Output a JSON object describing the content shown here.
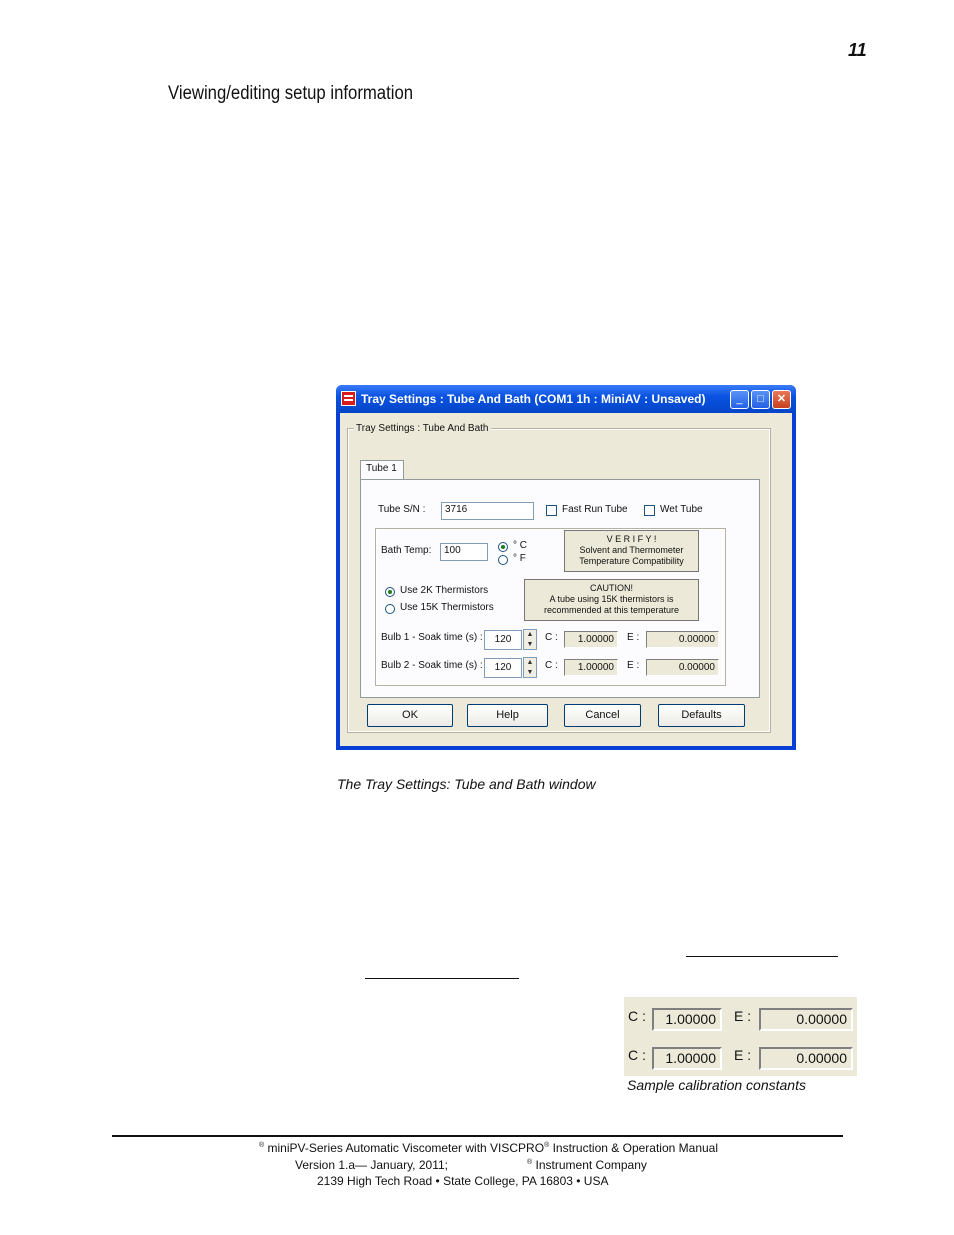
{
  "page": {
    "page_number": "11",
    "section_title": "Viewing/editing setup information"
  },
  "dialog": {
    "title": "Tray Settings : Tube And Bath (COM1 1h : MiniAV : Unsaved)",
    "minimize_glyph": "_",
    "maximize_glyph": "□",
    "close_glyph": "✕",
    "group_label": "Tray Settings : Tube And Bath",
    "tab_label": "Tube 1",
    "tube_sn_label": "Tube S/N :",
    "tube_sn_value": "3716",
    "fast_run_tube_label": "Fast Run Tube",
    "wet_tube_label": "Wet Tube",
    "bath_temp_label": "Bath Temp:",
    "bath_temp_value": "100",
    "unit_c": "° C",
    "unit_f": "° F",
    "verify_title": "V E R I F Y !",
    "verify_line1": "Solvent and Thermometer",
    "verify_line2": "Temperature Compatibility",
    "use_2k_label": "Use 2K Thermistors",
    "use_15k_label": "Use 15K Thermistors",
    "caution_title": "CAUTION!",
    "caution_line1": "A tube using 15K thermistors is",
    "caution_line2": "recommended at this temperature",
    "bulb1_label": "Bulb 1 - Soak time (s) :",
    "bulb1_soak": "120",
    "bulb1_c_label": "C :",
    "bulb1_c": "1.00000",
    "bulb1_e_label": "E :",
    "bulb1_e": "0.00000",
    "bulb2_label": "Bulb 2 - Soak time (s) :",
    "bulb2_soak": "120",
    "bulb2_c_label": "C :",
    "bulb2_c": "1.00000",
    "bulb2_e_label": "E :",
    "bulb2_e": "0.00000",
    "ok_label": "OK",
    "help_label": "Help",
    "cancel_label": "Cancel",
    "defaults_label": "Defaults",
    "spin_up": "▲",
    "spin_down": "▼"
  },
  "captions": {
    "window_caption": "The Tray Settings: Tube and Bath window",
    "sample_caption": "Sample calibration constants"
  },
  "sample_constants": {
    "row1_c_label": "C :",
    "row1_c": "1.00000",
    "row1_e_label": "E :",
    "row1_e": "0.00000",
    "row2_c_label": "C :",
    "row2_c": "1.00000",
    "row2_e_label": "E :",
    "row2_e": "0.00000"
  },
  "footer": {
    "registered": "®",
    "line1_main": "miniPV-Series Automatic Viscometer with VISCPRO",
    "line1_tail": "Instruction & Operation Manual",
    "line2_version": "Version 1.a— January, 2011;",
    "line2_company": "Instrument Company",
    "line3": "2139 High Tech Road • State College, PA  16803 • USA"
  }
}
